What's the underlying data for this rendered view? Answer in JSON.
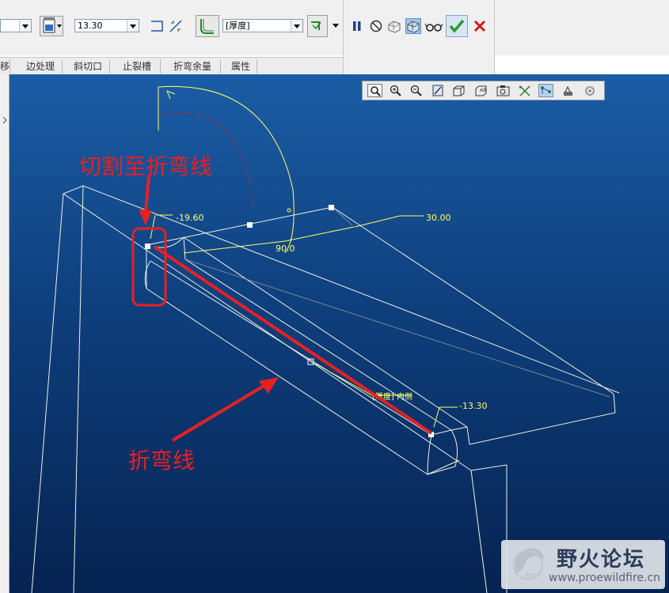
{
  "toolbar": {
    "thickness_value": "13.30",
    "thickness_option": "[厚度]"
  },
  "tabs": [
    "移",
    "边处理",
    "斜切口",
    "止裂槽",
    "折弯余量",
    "属性"
  ],
  "dimensions": {
    "offset_top": "-19.60",
    "length": "30.00",
    "angle": "90.0",
    "offset_bottom": "-13.30",
    "thickness_side": "[厚度] 内侧"
  },
  "annotations": {
    "cut_to_bend_line": "切割至折弯线",
    "bend_line": "折弯线"
  },
  "watermark": {
    "title": "野火论坛",
    "url": "www.proewildfire.cn"
  },
  "colors": {
    "annotation_red": "#e82020",
    "dimension_yellow": "#ffff66",
    "wireframe": "#f0f0e0",
    "viewport_top": "#1b5da6",
    "viewport_bottom": "#062352"
  }
}
